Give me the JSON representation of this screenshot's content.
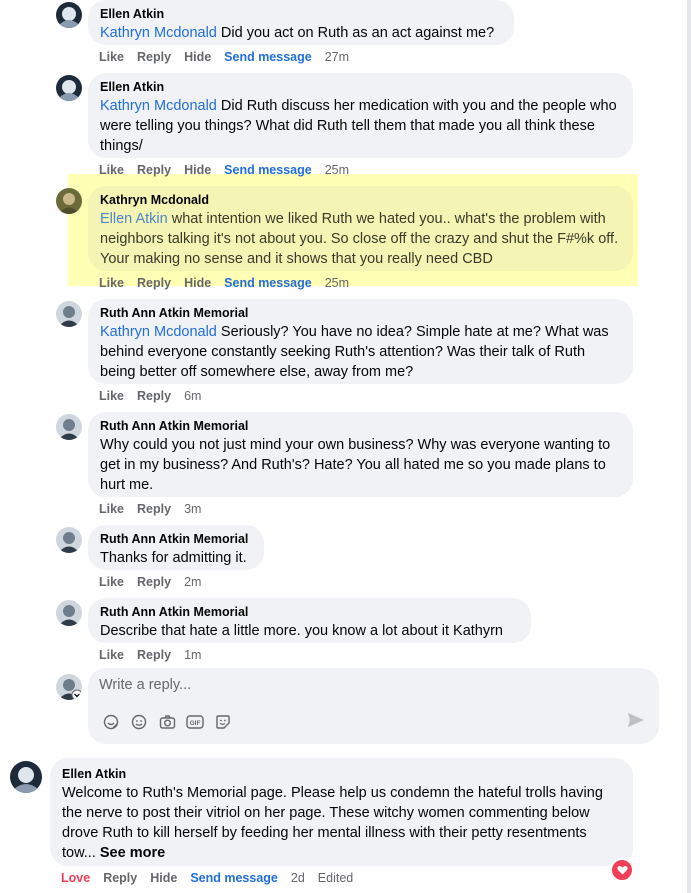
{
  "actions_labels": {
    "like": "Like",
    "reply": "Reply",
    "hide": "Hide",
    "send_message": "Send message",
    "love": "Love",
    "edited": "Edited"
  },
  "comments": [
    {
      "author": "Ellen Atkin",
      "mention": "Kathryn Mcdonald",
      "text": " Did you act on Ruth as an act against me?",
      "time": "27m"
    },
    {
      "author": "Ellen Atkin",
      "mention": "Kathryn Mcdonald",
      "text": " Did Ruth discuss her medication with you and the people who were telling you things? What did Ruth tell them that made you all think these things/",
      "time": "25m"
    },
    {
      "author": "Kathryn Mcdonald",
      "mention": "Ellen Atkin",
      "text": " what intention we liked Ruth we hated you.. what's the problem with neighbors talking it's not about you. So close off the crazy and shut the F#%k off. Your making no sense and it shows that you really need CBD",
      "time": "25m"
    },
    {
      "author": "Ruth Ann Atkin Memorial",
      "mention": "Kathryn Mcdonald",
      "text": " Seriously? You have no idea? Simple hate at me? What was behind everyone constantly seeking Ruth's attention? Was their talk of Ruth being better off somewhere else, away from me?",
      "time": "6m"
    },
    {
      "author": "Ruth Ann Atkin Memorial",
      "mention": "",
      "text": "Why could you not just mind your own business? Why was everyone wanting to get in my business? And Ruth's? Hate? You all hated me so you made plans to hurt me.",
      "time": "3m"
    },
    {
      "author": "Ruth Ann Atkin Memorial",
      "mention": "",
      "text": "Thanks for admitting it.",
      "time": "2m"
    },
    {
      "author": "Ruth Ann Atkin Memorial",
      "mention": "",
      "text": "Describe that hate a little more. you know a lot about it Kathyrn",
      "time": "1m"
    }
  ],
  "reply_box": {
    "placeholder": "Write a reply..."
  },
  "post": {
    "author": "Ellen Atkin",
    "text": "Welcome to Ruth's Memorial page. Please help us condemn the hateful trolls having the nerve to post their vitriol on her page. These witchy women commenting below drove Ruth to kill herself by feeding her mental illness with their petty resentments tow...",
    "see_more": "See more",
    "time": "2d"
  },
  "icons": [
    "sticker-icon",
    "emoji-icon",
    "camera-icon",
    "gif-icon",
    "avatar-sticker-icon",
    "send-icon",
    "heart-icon"
  ],
  "colors": {
    "mention": "#216fdb",
    "highlight": "#ffffa8",
    "love": "#f33e58",
    "bubble": "#f0f2f5"
  }
}
